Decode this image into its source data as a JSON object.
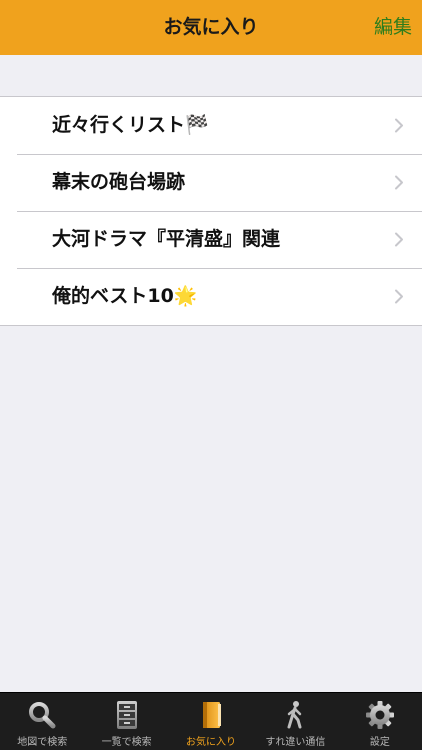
{
  "nav": {
    "title": "お気に入り",
    "edit_label": "編集"
  },
  "favorites": [
    {
      "label": "近々行くリスト🏁",
      "icon": "chevron-right-icon"
    },
    {
      "label": "幕末の砲台場跡",
      "icon": "chevron-right-icon"
    },
    {
      "label": "大河ドラマ『平清盛』関連",
      "icon": "chevron-right-icon"
    },
    {
      "label": "俺的ベスト10🌟",
      "icon": "chevron-right-icon"
    }
  ],
  "tabs": [
    {
      "label": "地図で検索",
      "icon": "magnifier-icon",
      "active": false
    },
    {
      "label": "一覧で検索",
      "icon": "cabinet-icon",
      "active": false
    },
    {
      "label": "お気に入り",
      "icon": "book-icon",
      "active": true
    },
    {
      "label": "すれ違い通信",
      "icon": "walking-person-icon",
      "active": false
    },
    {
      "label": "設定",
      "icon": "gear-icon",
      "active": false
    }
  ],
  "colors": {
    "nav_background": "#f0a21d",
    "edit_text": "#2e7d1c",
    "active_tab": "#f0a21d",
    "tab_bar": "#1d1d1d",
    "page_background": "#efeff4"
  }
}
